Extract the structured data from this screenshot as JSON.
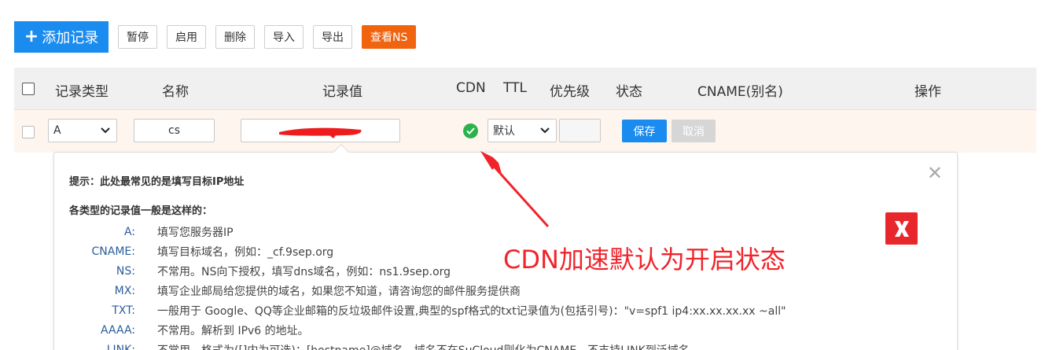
{
  "toolbar": {
    "add_label": "添加记录",
    "pause_label": "暂停",
    "enable_label": "启用",
    "delete_label": "删除",
    "import_label": "导入",
    "export_label": "导出",
    "view_ns_label": "查看NS"
  },
  "table": {
    "headers": {
      "type": "记录类型",
      "name": "名称",
      "value": "记录值",
      "cdn": "CDN",
      "ttl": "TTL",
      "priority": "优先级",
      "status": "状态",
      "cname": "CNAME(别名)",
      "actions": "操作"
    }
  },
  "edit_row": {
    "type_value": "A",
    "name_value": "cs",
    "record_value": "",
    "cdn_enabled": true,
    "ttl_value": "默认",
    "priority_value": "",
    "save_label": "保存",
    "cancel_label": "取消"
  },
  "tooltip": {
    "title": "提示：此处最常见的是填写目标IP地址",
    "subtitle": "各类型的记录值一般是这样的：",
    "rows": [
      {
        "key": "A:",
        "text": "填写您服务器IP"
      },
      {
        "key": "CNAME:",
        "text": "填写目标域名，例如：_cf.9sep.org"
      },
      {
        "key": "NS:",
        "text": "不常用。NS向下授权，填写dns域名，例如：ns1.9sep.org"
      },
      {
        "key": "MX:",
        "text": "填写企业邮局给您提供的域名，如果您不知道，请咨询您的邮件服务提供商"
      },
      {
        "key": "TXT:",
        "text": "一般用于 Google、QQ等企业邮箱的反垃圾邮件设置,典型的spf格式的txt记录值为(包括引号)：\"v=spf1 ip4:xx.xx.xx.xx ~all\""
      },
      {
        "key": "AAAA:",
        "text": "不常用。解析到 IPv6 的地址。"
      },
      {
        "key": "LINK:",
        "text": "不常用。格式为([]内为可选)：[hostname]@域名，域名不在SuCloud则化为CNAME，不支持LINK到泛域名"
      }
    ]
  },
  "annotation": {
    "text": "CDN加速默认为开启状态",
    "color": "#f0242b"
  },
  "colors": {
    "primary": "#1a8cf0",
    "ns_button": "#f06410",
    "cdn_on": "#2bb24c",
    "row_highlight": "#fff5ef"
  }
}
